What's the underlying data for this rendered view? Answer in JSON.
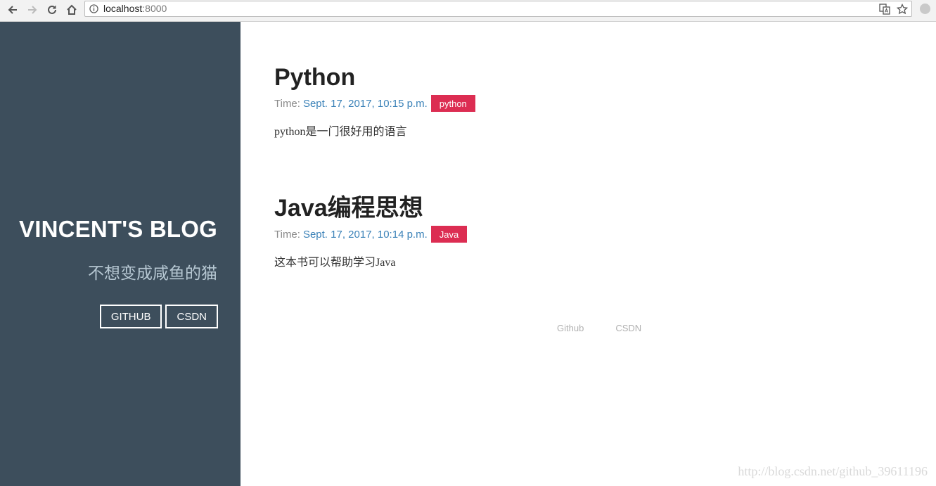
{
  "browser": {
    "url_host": "localhost",
    "url_port": ":8000"
  },
  "sidebar": {
    "title": "VINCENT'S BLOG",
    "subtitle": "不想变成咸鱼的猫",
    "links": [
      {
        "label": "GITHUB"
      },
      {
        "label": "CSDN"
      }
    ]
  },
  "posts": [
    {
      "title": "Python",
      "time_label": "Time:",
      "time": "Sept. 17, 2017, 10:15 p.m.",
      "tag": "python",
      "excerpt": "python是一门很好用的语言"
    },
    {
      "title": "Java编程思想",
      "time_label": "Time:",
      "time": "Sept. 17, 2017, 10:14 p.m.",
      "tag": "Java",
      "excerpt": "这本书可以帮助学习Java"
    }
  ],
  "footer": {
    "links": [
      {
        "label": "Github"
      },
      {
        "label": "CSDN"
      }
    ]
  },
  "watermark": "http://blog.csdn.net/github_39611196",
  "colors": {
    "sidebar_bg": "#3d4e5c",
    "tag_bg": "#dc2d52",
    "time_link": "#3b82b8"
  }
}
